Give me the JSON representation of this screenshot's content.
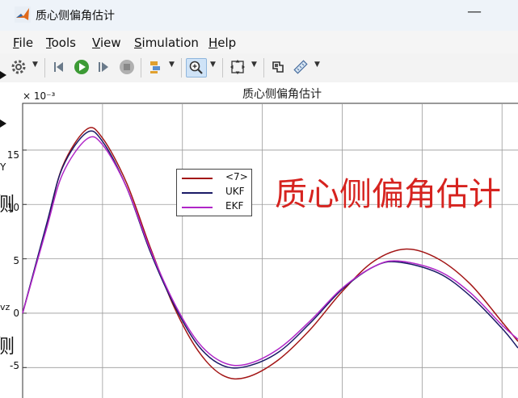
{
  "window": {
    "title": "质心侧偏角估计"
  },
  "menu": [
    {
      "label": "File",
      "ul": "F",
      "rest": "ile"
    },
    {
      "label": "Tools",
      "ul": "T",
      "rest": "ools"
    },
    {
      "label": "View",
      "ul": "V",
      "rest": "iew"
    },
    {
      "label": "Simulation",
      "ul": "S",
      "rest": "imulation"
    },
    {
      "label": "Help",
      "ul": "H",
      "rest": "elp"
    }
  ],
  "toolbar": {
    "icons": [
      "settings-icon",
      "step-back-icon",
      "run-icon",
      "step-forward-icon",
      "stop-icon",
      "signal-select-icon",
      "zoom-icon",
      "fit-view-icon",
      "style-icon",
      "measure-icon"
    ]
  },
  "background_fragments": {
    "port_y": "Y",
    "port_vz": "vz",
    "char_1": "侧",
    "char_2": "侧"
  },
  "chart_data": {
    "type": "line",
    "title": "质心侧偏角估计",
    "y_exponent": "× 10⁻³",
    "yticks": [
      "15",
      "10",
      "5",
      "0",
      "-5"
    ],
    "ytick_values": [
      15,
      10,
      5,
      0,
      -5
    ],
    "ylim": [
      -7.8,
      19.3
    ],
    "xlim": [
      0,
      6.2
    ],
    "grid": true,
    "legend_position": "top-center",
    "series": [
      {
        "name": "<7>",
        "color": "#a31515",
        "points": [
          [
            0,
            0.0
          ],
          [
            0.3,
            8.0
          ],
          [
            0.5,
            13.5
          ],
          [
            0.8,
            16.9
          ],
          [
            1.0,
            16.1
          ],
          [
            1.3,
            12.0
          ],
          [
            1.6,
            6.0
          ],
          [
            1.9,
            0.5
          ],
          [
            2.2,
            -3.5
          ],
          [
            2.5,
            -5.7
          ],
          [
            2.8,
            -5.9
          ],
          [
            3.2,
            -4.3
          ],
          [
            3.6,
            -1.5
          ],
          [
            4.0,
            2.0
          ],
          [
            4.4,
            4.8
          ],
          [
            4.8,
            5.9
          ],
          [
            5.2,
            5.0
          ],
          [
            5.6,
            2.7
          ],
          [
            6.0,
            -0.8
          ],
          [
            6.2,
            -2.6
          ]
        ]
      },
      {
        "name": "UKF",
        "color": "#1a1a66",
        "points": [
          [
            0,
            0.0
          ],
          [
            0.3,
            8.2
          ],
          [
            0.5,
            13.4
          ],
          [
            0.8,
            16.6
          ],
          [
            1.0,
            15.8
          ],
          [
            1.3,
            11.6
          ],
          [
            1.6,
            5.6
          ],
          [
            1.9,
            0.7
          ],
          [
            2.2,
            -3.0
          ],
          [
            2.5,
            -4.8
          ],
          [
            2.8,
            -4.9
          ],
          [
            3.2,
            -3.6
          ],
          [
            3.6,
            -0.9
          ],
          [
            4.0,
            2.2
          ],
          [
            4.4,
            4.3
          ],
          [
            4.7,
            4.7
          ],
          [
            5.2,
            3.7
          ],
          [
            5.6,
            1.6
          ],
          [
            6.0,
            -1.4
          ],
          [
            6.2,
            -3.2
          ]
        ]
      },
      {
        "name": "EKF",
        "color": "#b026c8",
        "points": [
          [
            0,
            0.0
          ],
          [
            0.3,
            7.8
          ],
          [
            0.5,
            12.8
          ],
          [
            0.8,
            16.0
          ],
          [
            1.0,
            15.5
          ],
          [
            1.3,
            11.6
          ],
          [
            1.6,
            5.8
          ],
          [
            1.9,
            0.9
          ],
          [
            2.2,
            -2.7
          ],
          [
            2.5,
            -4.5
          ],
          [
            2.8,
            -4.7
          ],
          [
            3.2,
            -3.3
          ],
          [
            3.6,
            -0.7
          ],
          [
            4.0,
            2.3
          ],
          [
            4.4,
            4.3
          ],
          [
            4.7,
            4.8
          ],
          [
            5.2,
            3.9
          ],
          [
            5.6,
            1.9
          ],
          [
            6.0,
            -1.1
          ],
          [
            6.2,
            -2.4
          ]
        ]
      }
    ],
    "annotation": "质心侧偏角估计"
  }
}
